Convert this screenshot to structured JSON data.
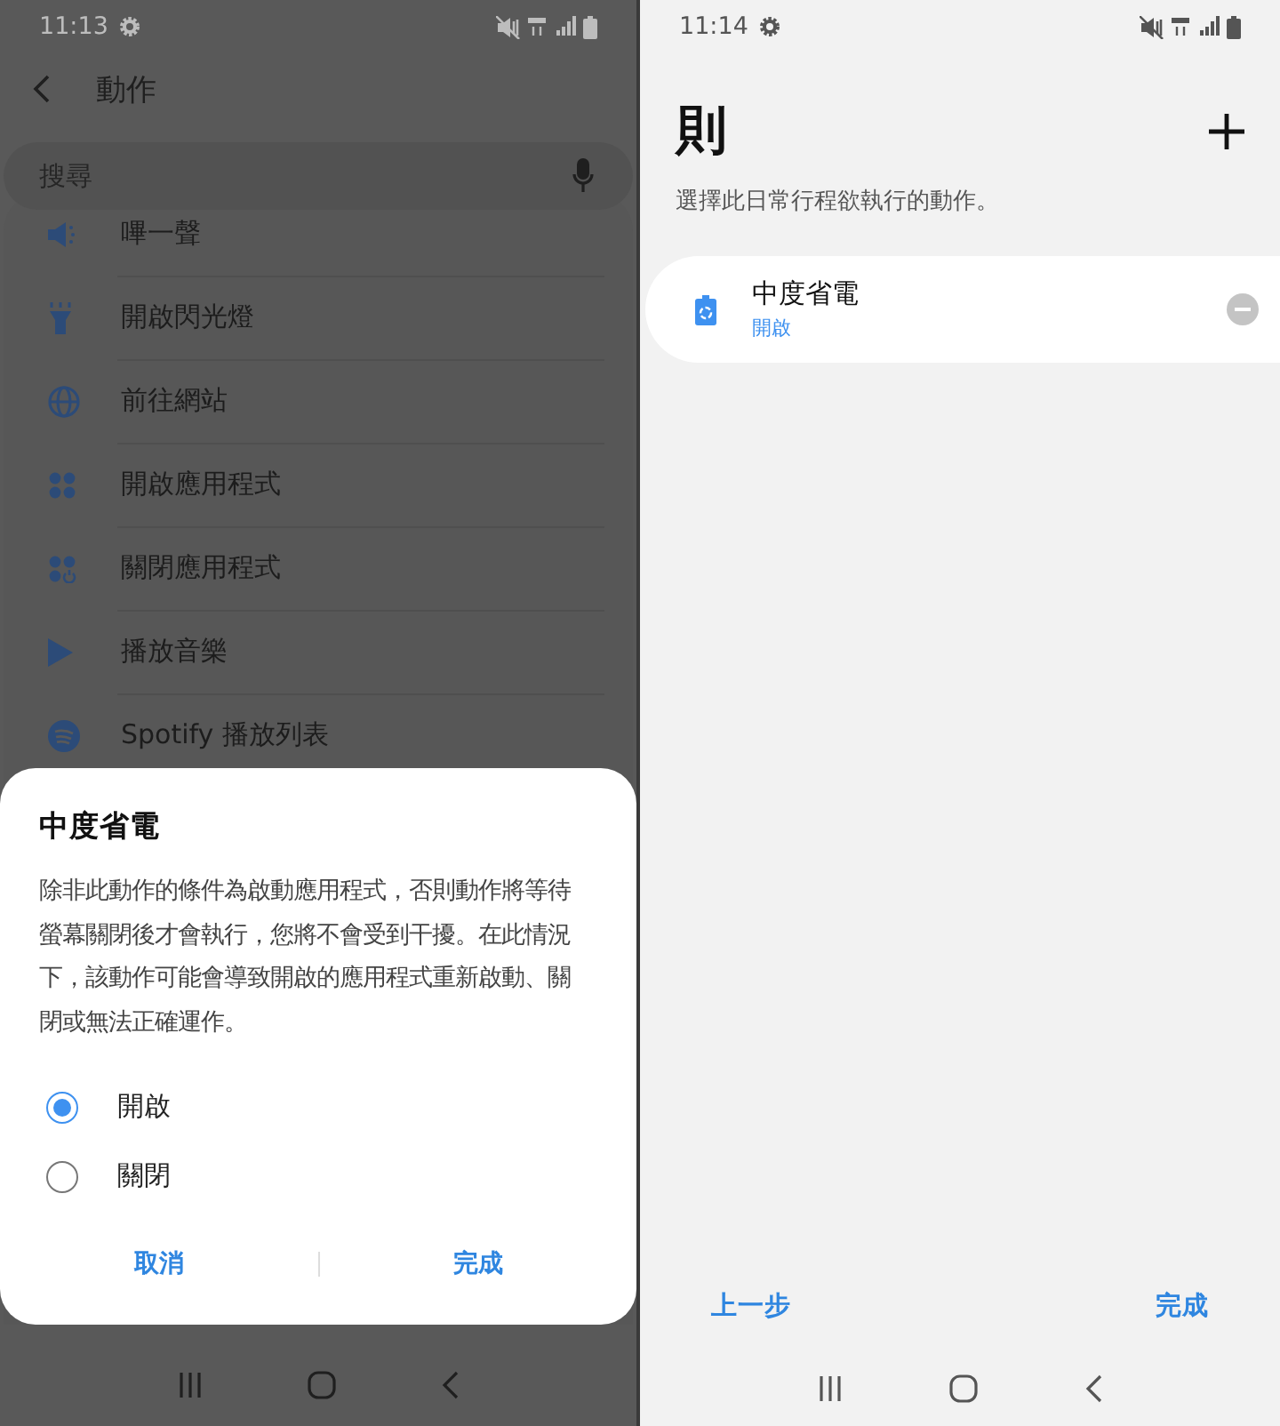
{
  "left_screen": {
    "status_bar": {
      "time": "11:13"
    },
    "header": {
      "title": "動作"
    },
    "search": {
      "placeholder": "搜尋"
    },
    "actions": [
      {
        "kind": "beep",
        "label": "嗶一聲"
      },
      {
        "kind": "flashlight",
        "label": "開啟閃光燈"
      },
      {
        "kind": "globe",
        "label": "前往網站"
      },
      {
        "kind": "apps",
        "label": "開啟應用程式"
      },
      {
        "kind": "apps-close",
        "label": "關閉應用程式"
      },
      {
        "kind": "play",
        "label": "播放音樂"
      },
      {
        "kind": "playlist",
        "label": "Spotify 播放列表"
      }
    ],
    "dialog": {
      "title": "中度省電",
      "message": "除非此動作的條件為啟動應用程式，否則動作將等待螢幕關閉後才會執行，您將不會受到干擾。在此情況下，該動作可能會導致開啟的應用程式重新啟動、關閉或無法正確運作。",
      "options": [
        {
          "label": "開啟",
          "selected": true
        },
        {
          "label": "關閉",
          "selected": false
        }
      ],
      "buttons": [
        "取消",
        "完成"
      ]
    }
  },
  "right_screen": {
    "status_bar": {
      "time": "11:14"
    },
    "title": "則",
    "subtitle": "選擇此日常行程欲執行的動作。",
    "actions": [
      {
        "title": "中度省電",
        "status": "開啟"
      }
    ],
    "buttons": [
      "上一步",
      "完成"
    ]
  }
}
